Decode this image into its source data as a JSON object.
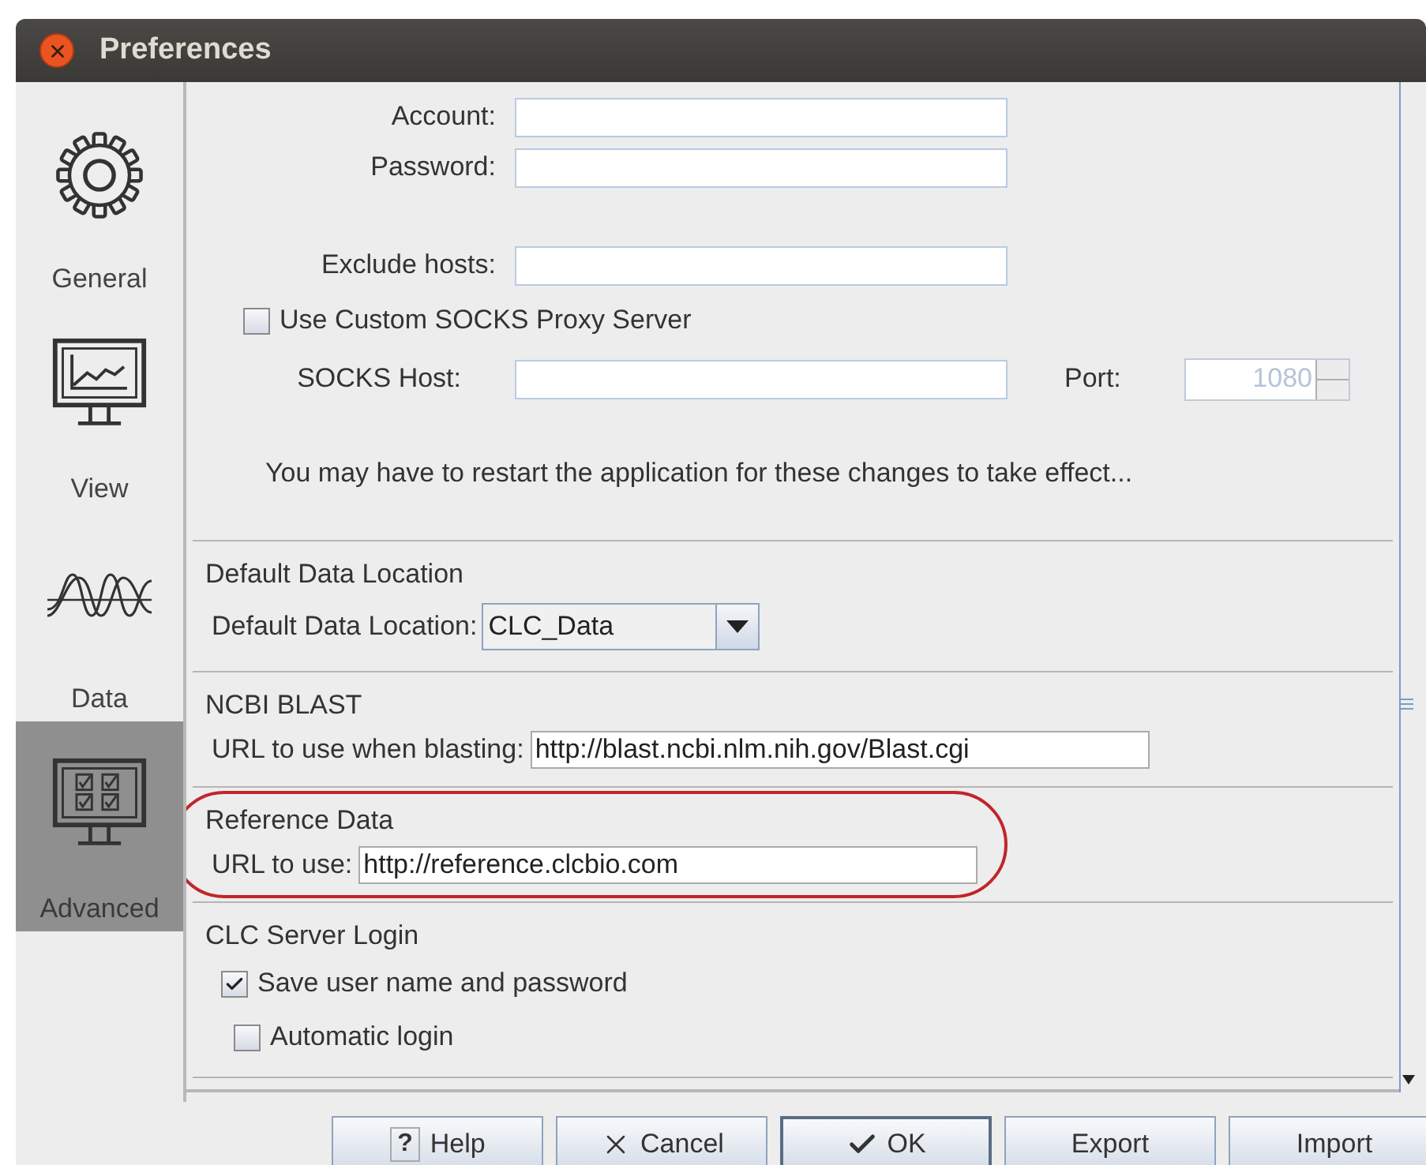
{
  "window": {
    "title": "Preferences"
  },
  "sidebar": {
    "items": [
      {
        "label": "General",
        "selected": false
      },
      {
        "label": "View",
        "selected": false
      },
      {
        "label": "Data",
        "selected": false
      },
      {
        "label": "Advanced",
        "selected": true
      }
    ]
  },
  "proxy": {
    "rows": [
      {
        "kind": "field",
        "label": "Account:"
      },
      {
        "kind": "field",
        "label": "Password:"
      },
      {
        "kind": "spacer"
      },
      {
        "kind": "field",
        "label": "Exclude hosts:"
      },
      {
        "kind": "checkbox",
        "label": "Use Custom SOCKS Proxy Server",
        "checked": false
      },
      {
        "kind": "host",
        "label": "SOCKS Host:",
        "port_label": "Port:",
        "port_value": "1080",
        "port_disabled": true
      }
    ],
    "message": "You may have to restart the application for these changes to take effect..."
  },
  "sections": [
    {
      "title": "Default Data Location",
      "highlighted": false,
      "rows": [
        {
          "kind": "combo",
          "label": "Default Data Location:",
          "value": "CLC_Data"
        }
      ]
    },
    {
      "title": "NCBI BLAST",
      "highlighted": false,
      "rows": [
        {
          "kind": "url",
          "label": "URL to use when blasting:",
          "value": "http://blast.ncbi.nlm.nih.gov/Blast.cgi"
        }
      ]
    },
    {
      "title": "Reference Data",
      "highlighted": true,
      "rows": [
        {
          "kind": "url",
          "label": "URL to use:",
          "value": "http://reference.clcbio.com"
        }
      ]
    },
    {
      "title": "CLC Server Login",
      "highlighted": false,
      "rows": [
        {
          "kind": "checkbox",
          "label": "Save user name and password",
          "checked": true
        },
        {
          "kind": "checkbox2",
          "label": "Automatic login",
          "checked": false
        }
      ]
    }
  ],
  "buttons": [
    {
      "label": "Help",
      "glyph": "?",
      "default": false
    },
    {
      "label": "Cancel",
      "default": false
    },
    {
      "label": "OK",
      "default": true
    },
    {
      "label": "Export",
      "default": false
    },
    {
      "label": "Import",
      "default": false
    }
  ]
}
